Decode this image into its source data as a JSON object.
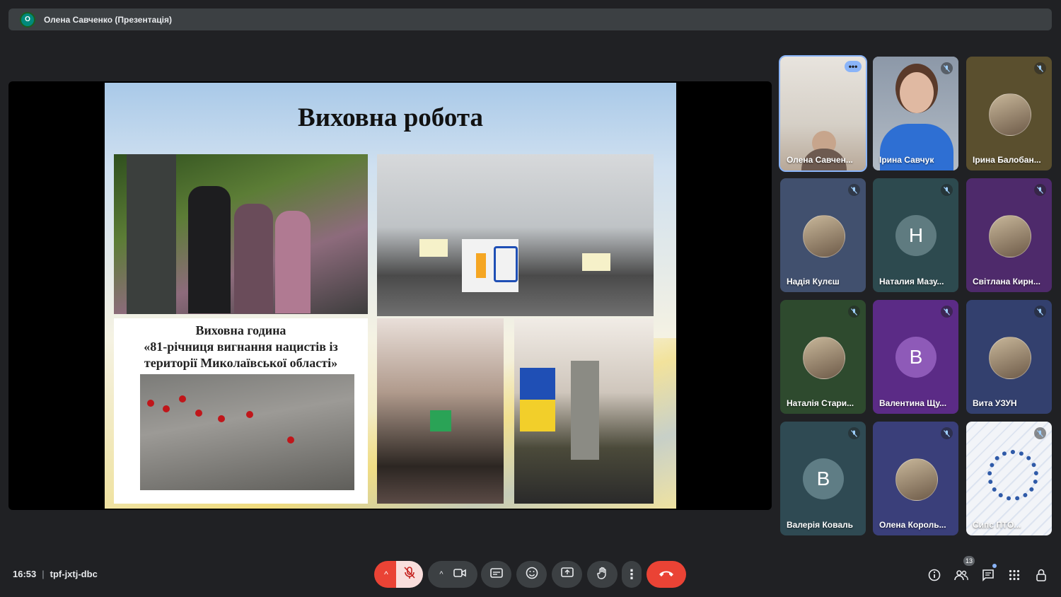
{
  "presenter_bar": {
    "avatar_letter": "О",
    "label": "Олена Савченко (Презентація)"
  },
  "slide": {
    "title": "Виховна робота",
    "panel_text_line1": "Виховна година",
    "panel_text_line2": "«81-річниця вигнання нацистів із",
    "panel_text_line3": "території Миколаївської області»"
  },
  "participants": [
    {
      "name": "Олена Савчен...",
      "type": "video",
      "bg": "#d9d3c8"
    },
    {
      "name": "Ірина Савчук",
      "type": "video",
      "bg": "#6f7f93"
    },
    {
      "name": "Ірина Балобан...",
      "type": "photo",
      "bg": "#5a4f2e"
    },
    {
      "name": "Надія Кулєш",
      "type": "photo",
      "bg": "#41506e"
    },
    {
      "name": "Наталия Мазу...",
      "type": "letter",
      "letter": "Н",
      "bg": "#2d4a4f",
      "avatar_bg": "#5f7b80"
    },
    {
      "name": "Світлана Кирн...",
      "type": "photo",
      "bg": "#4e2a6b"
    },
    {
      "name": "Наталія Стари...",
      "type": "photo",
      "bg": "#2e4a2e"
    },
    {
      "name": "Валентина Щу...",
      "type": "letter",
      "letter": "В",
      "bg": "#5b2b86",
      "avatar_bg": "#8e5ab8"
    },
    {
      "name": "Вита УЗУН",
      "type": "photo",
      "bg": "#33406e"
    },
    {
      "name": "Валерія Коваль",
      "type": "letter",
      "letter": "В",
      "bg": "#2f4a53",
      "avatar_bg": "#5f7d85"
    },
    {
      "name": "Олена Король...",
      "type": "photo",
      "bg": "#3a3f7a"
    },
    {
      "name": "Сипс ПТО...",
      "type": "pattern",
      "bg": "#f2f4f8"
    }
  ],
  "meeting": {
    "time": "16:53",
    "code": "tpf-jxtj-dbc",
    "participant_count": "13"
  }
}
